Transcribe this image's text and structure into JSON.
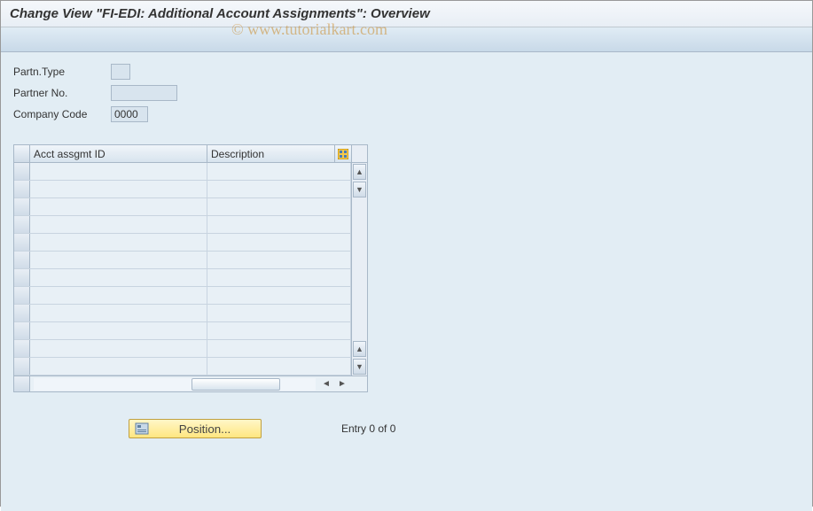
{
  "title": "Change View \"FI-EDI: Additional Account Assignments\": Overview",
  "watermark": "© www.tutorialkart.com",
  "form": {
    "partn_type": {
      "label": "Partn.Type",
      "value": ""
    },
    "partner_no": {
      "label": "Partner No.",
      "value": ""
    },
    "company_code": {
      "label": "Company Code",
      "value": "0000"
    }
  },
  "table": {
    "columns": {
      "acct_assgmt_id": "Acct assgmt ID",
      "description": "Description"
    },
    "rows": [
      {
        "id": "",
        "desc": ""
      },
      {
        "id": "",
        "desc": ""
      },
      {
        "id": "",
        "desc": ""
      },
      {
        "id": "",
        "desc": ""
      },
      {
        "id": "",
        "desc": ""
      },
      {
        "id": "",
        "desc": ""
      },
      {
        "id": "",
        "desc": ""
      },
      {
        "id": "",
        "desc": ""
      },
      {
        "id": "",
        "desc": ""
      },
      {
        "id": "",
        "desc": ""
      },
      {
        "id": "",
        "desc": ""
      },
      {
        "id": "",
        "desc": ""
      }
    ]
  },
  "footer": {
    "position_label": "Position...",
    "entry_text": "Entry 0 of 0"
  }
}
